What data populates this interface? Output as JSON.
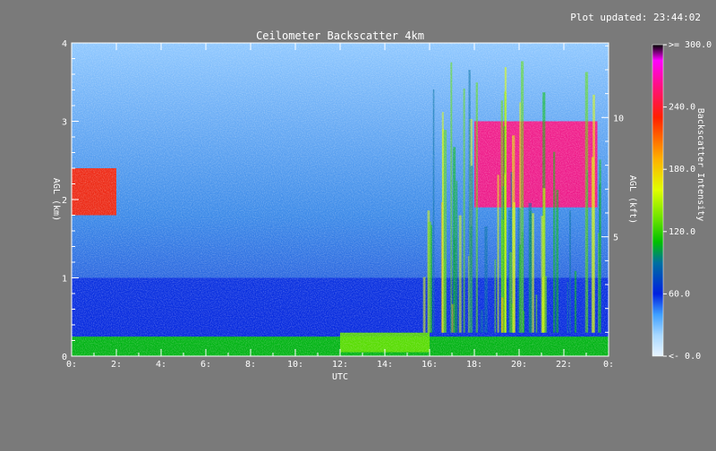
{
  "header": {
    "updated_text": "Plot updated: 23:44:02"
  },
  "chart_data": {
    "type": "heatmap",
    "title": "Ceilometer Backscatter 4km",
    "xlabel": "UTC",
    "ylabel_left": "AGL (km)",
    "ylabel_right": "AGL (kft)",
    "xlim": [
      0,
      24
    ],
    "ylim_km": [
      0,
      4
    ],
    "ylim_kft": [
      0,
      13.123
    ],
    "x_ticks": [
      "0:",
      "2:",
      "4:",
      "6:",
      "8:",
      "10:",
      "12:",
      "14:",
      "16:",
      "18:",
      "20:",
      "22:",
      "0:"
    ],
    "x_tick_values": [
      0,
      2,
      4,
      6,
      8,
      10,
      12,
      14,
      16,
      18,
      20,
      22,
      24
    ],
    "y_ticks_km": [
      "0",
      "1",
      "2",
      "3",
      "4"
    ],
    "y_ticks_km_values": [
      0,
      1,
      2,
      3,
      4
    ],
    "y_ticks_kft": [
      "5",
      "10"
    ],
    "y_ticks_kft_values": [
      5,
      10
    ],
    "colorbar": {
      "label": "Backscatter Intensity",
      "range": [
        0,
        300
      ],
      "ticks": [
        "<- 0.0",
        "60.0",
        "120.0",
        "180.0",
        "240.0",
        ">= 300.0"
      ],
      "tick_values": [
        0,
        60,
        120,
        180,
        240,
        300
      ],
      "stops": [
        {
          "v": 0,
          "color": "#e8f4ff"
        },
        {
          "v": 20,
          "color": "#a8d8ff"
        },
        {
          "v": 40,
          "color": "#3fa0ff"
        },
        {
          "v": 60,
          "color": "#0020e0"
        },
        {
          "v": 90,
          "color": "#0070a0"
        },
        {
          "v": 110,
          "color": "#00c000"
        },
        {
          "v": 130,
          "color": "#60e000"
        },
        {
          "v": 160,
          "color": "#e0ff00"
        },
        {
          "v": 190,
          "color": "#ffb000"
        },
        {
          "v": 230,
          "color": "#ff2000"
        },
        {
          "v": 260,
          "color": "#ff1080"
        },
        {
          "v": 285,
          "color": "#ff00ff"
        },
        {
          "v": 300,
          "color": "#000000"
        }
      ]
    },
    "features": [
      {
        "name": "surface-layer",
        "x": [
          0,
          24
        ],
        "y_km": [
          0,
          0.25
        ],
        "level": 110
      },
      {
        "name": "boundary-layer",
        "x": [
          0,
          24
        ],
        "y_km": [
          0.25,
          1.0
        ],
        "level": 60
      },
      {
        "name": "residual-layer-glow",
        "x": [
          12,
          16
        ],
        "y_km": [
          0.05,
          0.3
        ],
        "level": 130
      },
      {
        "name": "early-cloud-layer",
        "x": [
          0,
          2
        ],
        "y_km": [
          1.8,
          2.4
        ],
        "level": 230
      },
      {
        "name": "late-cloud-layer",
        "x": [
          18,
          23.5
        ],
        "y_km": [
          1.9,
          3.0
        ],
        "level": 280
      }
    ]
  }
}
